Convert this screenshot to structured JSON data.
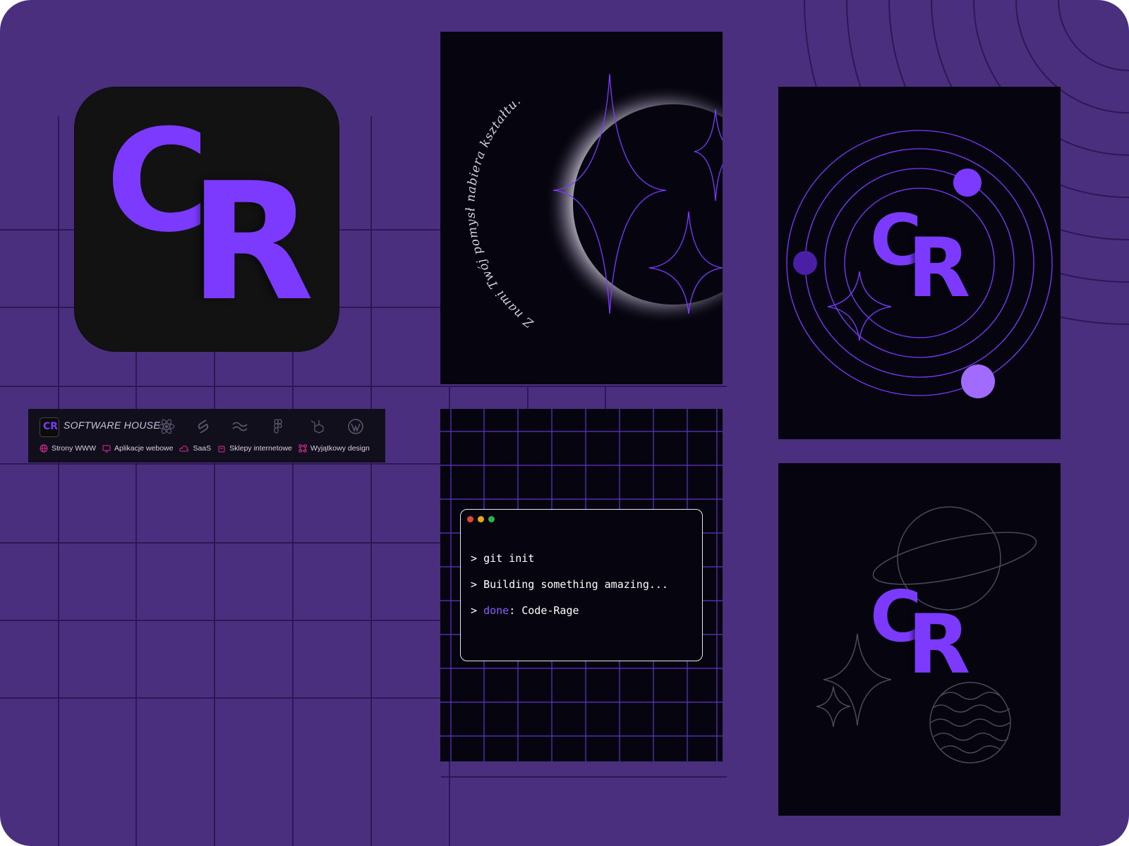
{
  "logo": {
    "letter_c": "C",
    "letter_r": "R"
  },
  "banner": {
    "logo_text": "CR",
    "brand": "SOFTWARE HOUSE",
    "tech_icons": [
      "react-icon",
      "svelte-icon",
      "tailwind-icon",
      "figma-icon",
      "laravel-icon",
      "wordpress-icon"
    ],
    "services": [
      {
        "label": "Strony WWW",
        "icon": "globe-icon"
      },
      {
        "label": "Aplikacje webowe",
        "icon": "monitor-icon"
      },
      {
        "label": "SaaS",
        "icon": "cloud-icon"
      },
      {
        "label": "Sklepy internetowe",
        "icon": "shopping-bag-icon"
      },
      {
        "label": "Wyjątkowy design",
        "icon": "vector-design-icon"
      }
    ]
  },
  "eclipse_poster": {
    "tagline": "Z nami Twój pomysł nabiera kształtu."
  },
  "terminal": {
    "lines": [
      {
        "prompt": ">",
        "text": "git init"
      },
      {
        "prompt": ">",
        "text": "Building something amazing..."
      },
      {
        "prompt": ">",
        "keyword": "done",
        "rest": ": Code-Rage"
      }
    ]
  },
  "colors": {
    "background": "#4b2f7f",
    "accent": "#7c3aff",
    "panel": "#06040f",
    "banner_pink": "#e0289a",
    "window_dots": [
      "#e0443b",
      "#e8a917",
      "#2fb344"
    ]
  }
}
